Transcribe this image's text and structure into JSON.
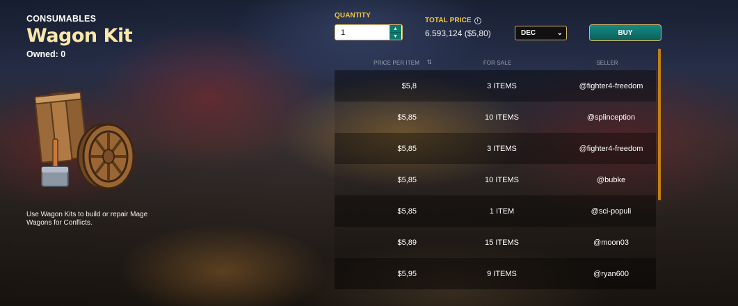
{
  "product": {
    "category": "CONSUMABLES",
    "title": "Wagon Kit",
    "owned": "Owned: 0",
    "description": "Use Wagon Kits to build or repair Mage Wagons for Conflicts."
  },
  "purchase": {
    "quantity_label": "QUANTITY",
    "quantity_value": "1",
    "total_price_label": "TOTAL PRICE",
    "total_price_value": "6.593,124 ($5,80)",
    "currency_selected": "DEC",
    "buy_label": "BUY"
  },
  "listings": {
    "columns": {
      "price": "PRICE PER ITEM",
      "for_sale": "FOR SALE",
      "seller": "SELLER"
    },
    "rows": [
      {
        "price": "$5,8",
        "for_sale": "3 ITEMS",
        "seller": "@fighter4-freedom"
      },
      {
        "price": "$5,85",
        "for_sale": "10 ITEMS",
        "seller": "@splinception"
      },
      {
        "price": "$5,85",
        "for_sale": "3 ITEMS",
        "seller": "@fighter4-freedom"
      },
      {
        "price": "$5,85",
        "for_sale": "10 ITEMS",
        "seller": "@bubke"
      },
      {
        "price": "$5,85",
        "for_sale": "1 ITEM",
        "seller": "@sci-populi"
      },
      {
        "price": "$5,89",
        "for_sale": "15 ITEMS",
        "seller": "@moon03"
      },
      {
        "price": "$5,95",
        "for_sale": "9 ITEMS",
        "seller": "@ryan600"
      }
    ]
  },
  "colors": {
    "accent_gold": "#f5c842",
    "title_cream": "#fbe7a8",
    "teal": "#148c85",
    "scrollbar": "#c47f12"
  },
  "icons": {
    "info": "info-icon",
    "sort": "sort-icon",
    "select_chevron": "chevron-down-icon",
    "stepper": "stepper-arrows-icon"
  }
}
